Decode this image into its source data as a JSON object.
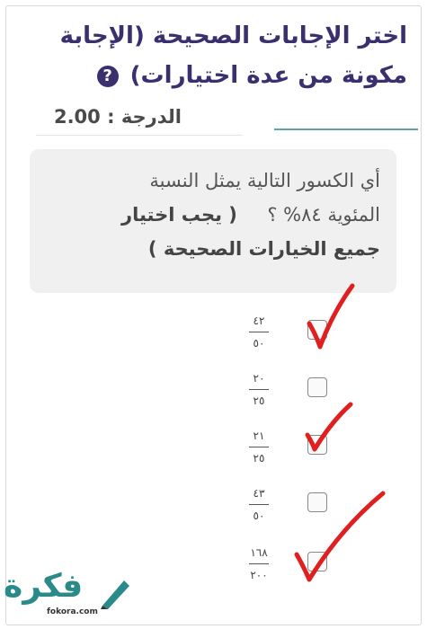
{
  "title_line1": "اختر الإجابات الصحيحة (الإجابة",
  "title_line2": "مكونة من عدة اختيارات)",
  "grade": "الدرجة : 2.00",
  "question_line1": "أي الكسور التالية يمثل النسبة",
  "question_line2_a": "المئوية ٨٤% ؟",
  "question_line2_b": "( يجب اختيار",
  "question_line3": "جميع الخيارات الصحيحة )",
  "options": [
    {
      "num": "٤٢",
      "den": "٥٠",
      "checked": true
    },
    {
      "num": "٢٠",
      "den": "٢٥",
      "checked": false
    },
    {
      "num": "٢١",
      "den": "٢٥",
      "checked": true
    },
    {
      "num": "٤٣",
      "den": "٥٠",
      "checked": false
    },
    {
      "num": "١٦٨",
      "den": "٢٠٠",
      "checked": true
    }
  ],
  "logo": {
    "text": "فكرة",
    "sub": "fokora.com"
  },
  "colors": {
    "title": "#3b2f6e",
    "checkmark": "#e02020",
    "logo": "#2a8a8a",
    "accent_line": "#5aa9a9"
  }
}
